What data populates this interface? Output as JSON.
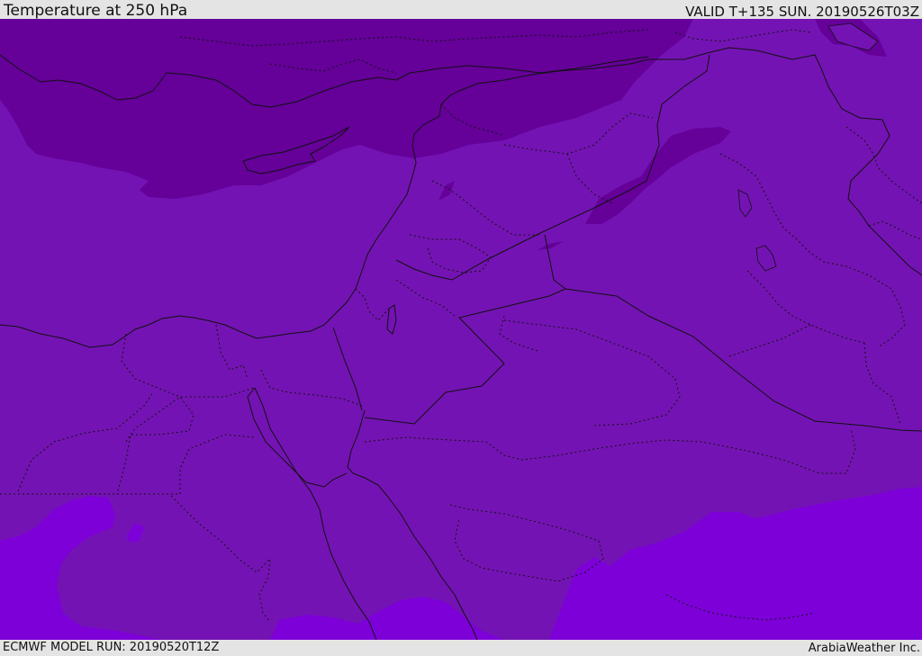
{
  "header": {
    "title": "Temperature at 250 hPa",
    "valid_time": "VALID T+135 SUN. 20190526T03Z"
  },
  "footer": {
    "model_run": "ECMWF MODEL RUN: 20190520T12Z",
    "credit": "ArabiaWeather Inc."
  },
  "map": {
    "colors": {
      "cold_band": "#650099",
      "mid_band": "#7413b3",
      "warm_band": "#7d00d9",
      "outline": "#111111"
    }
  }
}
